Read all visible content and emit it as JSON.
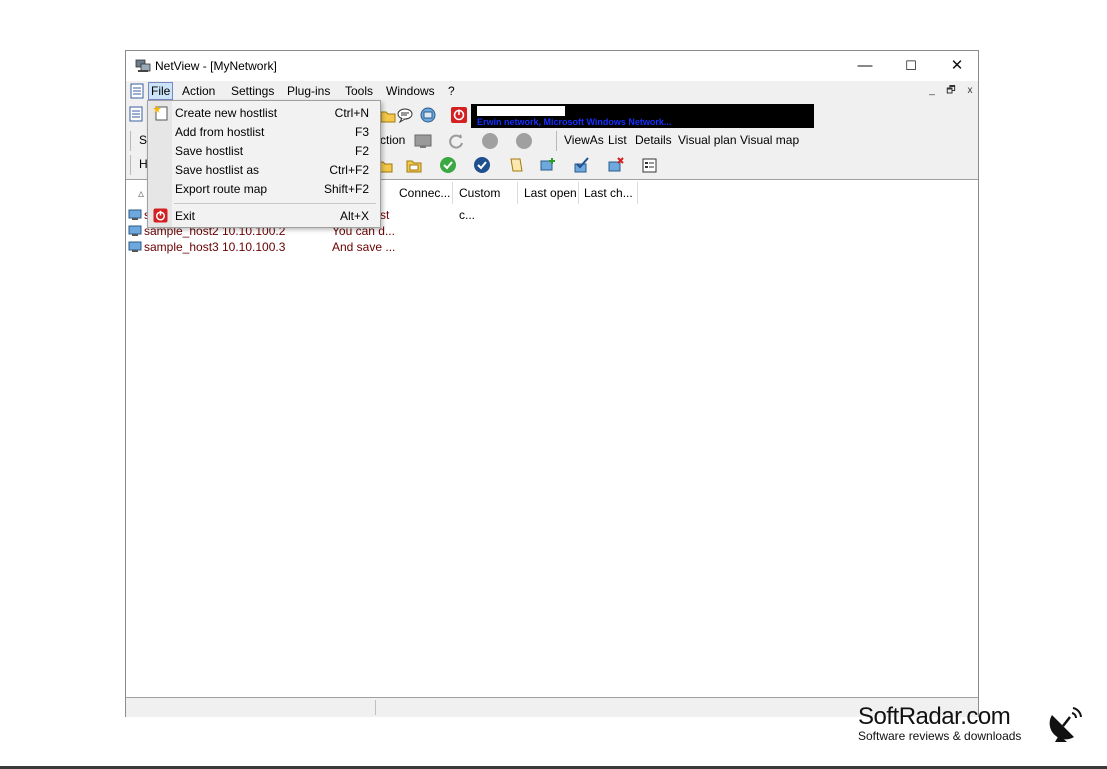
{
  "window": {
    "title": "NetView - [MyNetwork]"
  },
  "title_controls": {
    "minimize": "—",
    "maximize": "☐",
    "close": "✕"
  },
  "menubar": {
    "items": [
      "File",
      "Action",
      "Settings",
      "Plug-ins",
      "Tools",
      "Windows",
      "?"
    ],
    "active": "File",
    "mdi": {
      "minimize": "_",
      "restore": "🗗",
      "close": "x"
    }
  },
  "banner": {
    "text": "Erwin network, Microsoft Windows Network..."
  },
  "toolbar": {
    "partial_left_1": "S",
    "partial_left_2": "H",
    "action_label": "ction",
    "viewas": [
      "ViewAs",
      "List",
      "Details",
      "Visual plan",
      "Visual map"
    ]
  },
  "columns": [
    "Connec...",
    "Custom c...",
    "Last open",
    "Last ch..."
  ],
  "rows": [
    {
      "name": "s",
      "ip": "",
      "comment": "st"
    },
    {
      "name": "sample_host2",
      "ip": "10.10.100.2",
      "comment": "You can d..."
    },
    {
      "name": "sample_host3",
      "ip": "10.10.100.3",
      "comment": "And save ..."
    }
  ],
  "file_menu": {
    "items": [
      {
        "label": "Create new hostlist",
        "shortcut": "Ctrl+N",
        "icon": "new-hostlist-icon"
      },
      {
        "label": "Add from hostlist",
        "shortcut": "F3",
        "icon": ""
      },
      {
        "label": "Save hostlist",
        "shortcut": "F2",
        "icon": ""
      },
      {
        "label": "Save hostlist as",
        "shortcut": "Ctrl+F2",
        "icon": ""
      },
      {
        "label": "Export route map",
        "shortcut": "Shift+F2",
        "icon": ""
      },
      {
        "label": "Exit",
        "shortcut": "Alt+X",
        "icon": "power-icon"
      }
    ]
  },
  "watermark": {
    "brand": "SoftRadar.com",
    "tagline": "Software reviews & downloads"
  },
  "colors": {
    "accent": "#1530ff",
    "exit_icon": "#d42020",
    "menu_active": "#cce4f7"
  }
}
